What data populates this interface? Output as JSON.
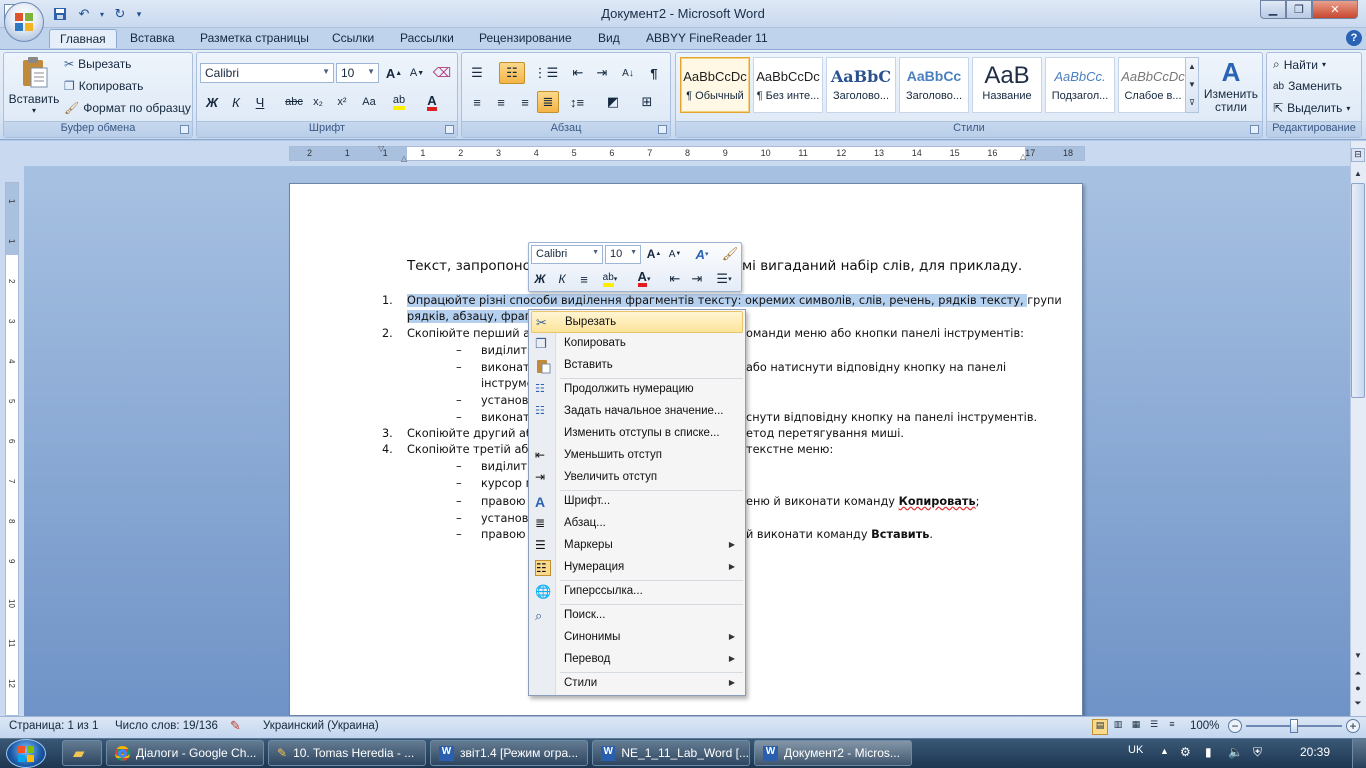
{
  "window": {
    "title": "Документ2 - Microsoft Word"
  },
  "qat": {
    "save": "save-icon",
    "undo": "undo-icon",
    "redo": "redo-icon"
  },
  "tabs": [
    "Главная",
    "Вставка",
    "Разметка страницы",
    "Ссылки",
    "Рассылки",
    "Рецензирование",
    "Вид",
    "ABBYY FineReader 11"
  ],
  "clipboard": {
    "paste": "Вставить",
    "cut": "Вырезать",
    "copy": "Копировать",
    "format_painter": "Формат по образцу",
    "label": "Буфер обмена"
  },
  "font": {
    "name": "Calibri",
    "size": "10",
    "label": "Шрифт",
    "bold": "Ж",
    "italic": "К",
    "underline": "Ч",
    "strike": "abc",
    "sub": "x₂",
    "sup": "x²",
    "case": "Aa",
    "grow": "A",
    "shrink": "A"
  },
  "paragraph": {
    "label": "Абзац"
  },
  "styles": {
    "label": "Стили",
    "items": [
      {
        "sample": "AaBbCcDc",
        "name": "¶ Обычный"
      },
      {
        "sample": "AaBbCcDc",
        "name": "¶ Без инте..."
      },
      {
        "sample": "AaBbC",
        "name": "Заголово..."
      },
      {
        "sample": "AaBbCc",
        "name": "Заголово..."
      },
      {
        "sample": "AaB",
        "name": "Название"
      },
      {
        "sample": "AaBbCc.",
        "name": "Подзагол..."
      },
      {
        "sample": "AaBbCcDc",
        "name": "Слабое в..."
      }
    ],
    "change": "Изменить стили"
  },
  "editing": {
    "find": "Найти",
    "replace": "Заменить",
    "select": "Выделить",
    "label": "Редактирование"
  },
  "ruler": {
    "ticks": [
      "2",
      "1",
      "1",
      "1",
      "2",
      "3",
      "4",
      "5",
      "6",
      "7",
      "8",
      "9",
      "10",
      "11",
      "12",
      "13",
      "14",
      "15",
      "16",
      "17",
      "18"
    ],
    "vticks": [
      "1",
      "1",
      "2",
      "3",
      "4",
      "5",
      "6",
      "7",
      "8",
      "9",
      "10",
      "11",
      "12"
    ]
  },
  "document": {
    "heading_left": "Текст, запропонов",
    "heading_right": "мі вигаданий набір слів, для прикладу.",
    "item1_num": "1.",
    "item1_line1": "Опрацюйте різні способи виділення фрагментів тексту: окремих символів, слів, речень, рядків тексту, групи",
    "item1_line2": "рядків, абзацу, фрагм",
    "item2_num": "2.",
    "item2_left": "Скопіюйте перший аб",
    "item2_right": "оманди меню або кнопки панелі інструментів:",
    "sub2a_left": "виділити",
    "sub2b_left": "виконати",
    "sub2b_right": "або  натиснути  відповідну  кнопку  на  панелі",
    "sub2b2_left": "інструме",
    "sub2c_left": "установи",
    "sub2d_left": "виконати",
    "sub2d_right": "снути відповідну  кнопку на панелі інструментів.",
    "item3_num": "3.",
    "item3_left": "Скопіюйте другий абз",
    "item3_right": "етод перетягування миші.",
    "item4_num": "4.",
    "item4_left": "Скопіюйте третій абза",
    "item4_right": "текстне меню:",
    "sub4a_left": "виділити",
    "sub4b_left": "курсор м",
    "sub4c_left": "правою",
    "sub4c_right": "еню й виконати  команду",
    "sub4c_bold": "Копировать",
    "sub4c_end": ";",
    "sub4d_left": "установи",
    "sub4e_left": "правою",
    "sub4e_right": "й виконати  команду",
    "sub4e_bold": "Вставить",
    "sub4e_end": ".",
    "dash": "–"
  },
  "minitoolbar": {
    "font": "Calibri",
    "size": "10"
  },
  "context_menu": {
    "items": [
      {
        "label": "Вырезать",
        "icon": "scissors-icon"
      },
      {
        "label": "Копировать",
        "icon": "copy-icon"
      },
      {
        "label": "Вставить",
        "icon": "paste-icon"
      },
      {
        "label": "Продолжить нумерацию",
        "icon": "continue-numbering-icon"
      },
      {
        "label": "Задать начальное значение...",
        "icon": "set-value-icon"
      },
      {
        "label": "Изменить отступы в списке...",
        "icon": ""
      },
      {
        "label": "Уменьшить отступ",
        "icon": "decrease-indent-icon"
      },
      {
        "label": "Увеличить отступ",
        "icon": "increase-indent-icon"
      },
      {
        "label": "Шрифт...",
        "icon": "font-icon"
      },
      {
        "label": "Абзац...",
        "icon": "paragraph-icon"
      },
      {
        "label": "Маркеры",
        "icon": "bullets-icon"
      },
      {
        "label": "Нумерация",
        "icon": "numbering-icon"
      },
      {
        "label": "Гиперссылка...",
        "icon": "hyperlink-icon"
      },
      {
        "label": "Поиск...",
        "icon": "research-icon"
      },
      {
        "label": "Синонимы",
        "icon": ""
      },
      {
        "label": "Перевод",
        "icon": ""
      },
      {
        "label": "Стили",
        "icon": ""
      }
    ]
  },
  "status": {
    "page": "Страница: 1 из 1",
    "words": "Число слов: 19/136",
    "language": "Украинский (Украина)",
    "zoom": "100%"
  },
  "taskbar": {
    "tasks": [
      "Діалоги - Google Ch...",
      "10. Tomas Heredia - ...",
      "звіт1.4 [Режим огра...",
      "NE_1_11_Lab_Word [...",
      "Документ2 - Micros..."
    ],
    "lang": "UK",
    "time": "20:39"
  }
}
